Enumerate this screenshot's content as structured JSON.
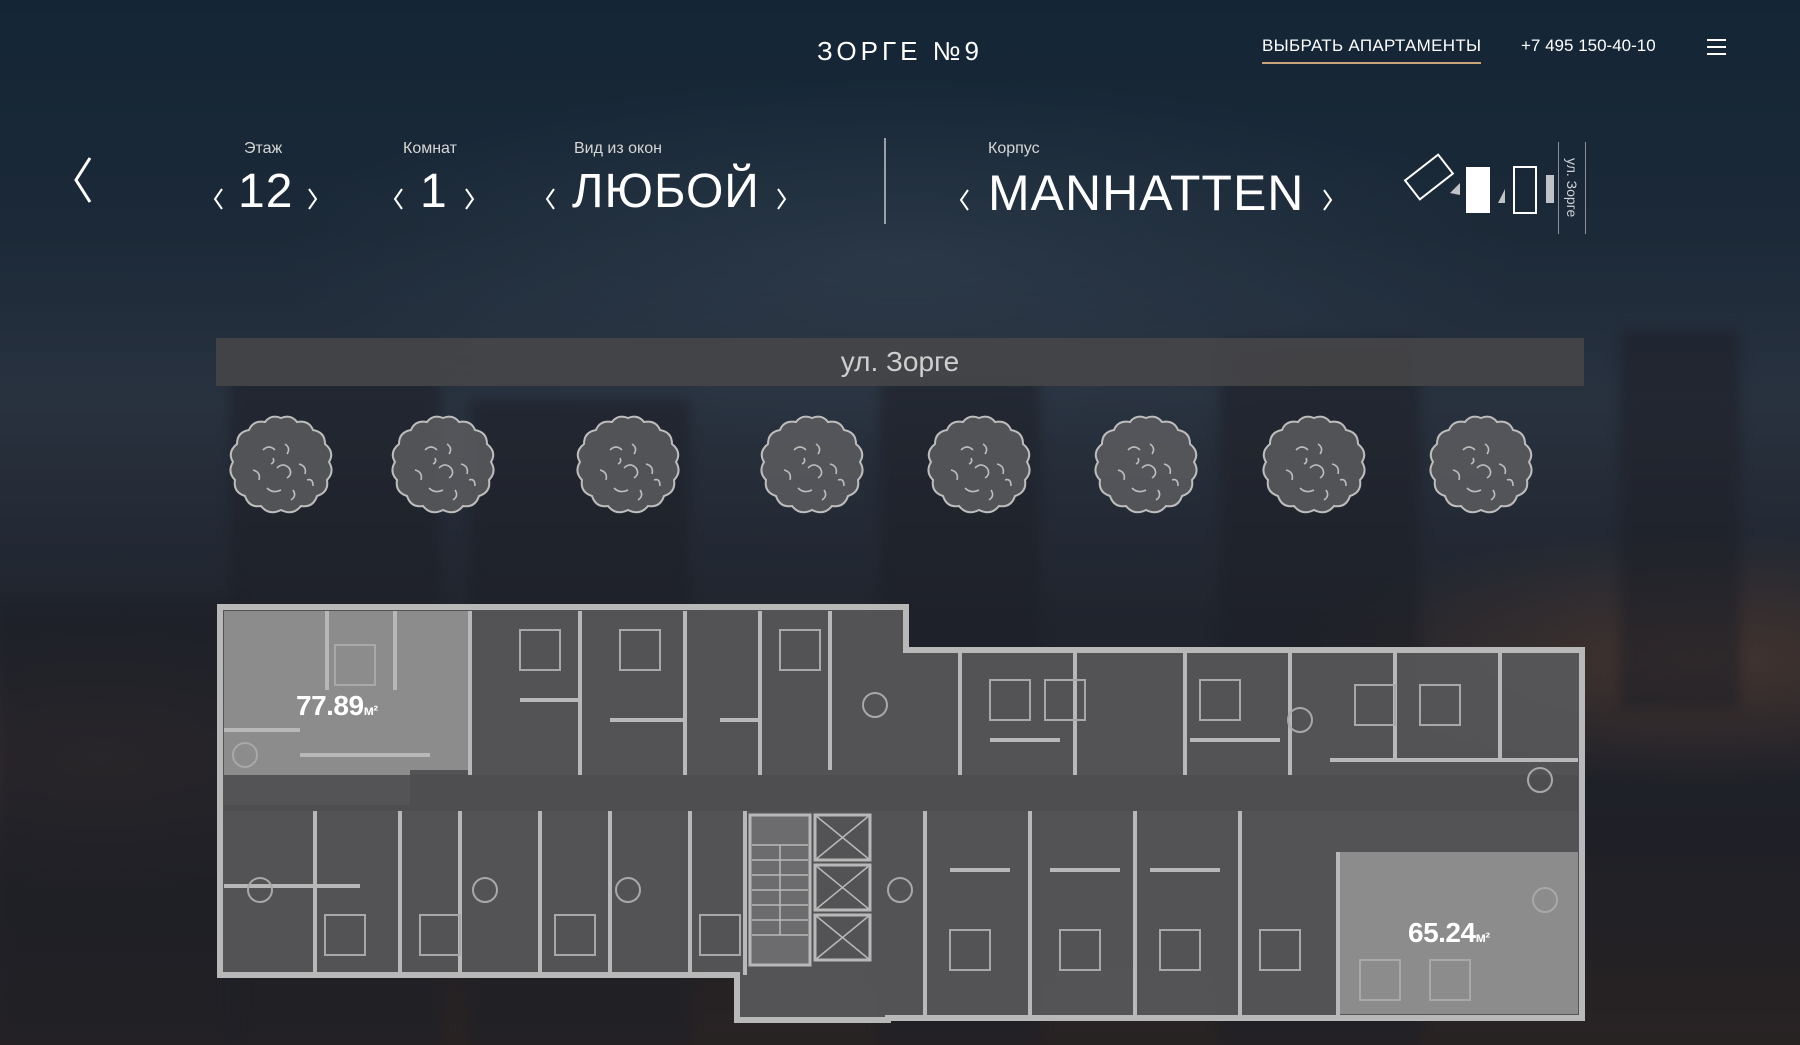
{
  "header": {
    "logo": "ЗОРГЕ №9",
    "choose_link": "ВЫБРАТЬ АПАРТАМЕНТЫ",
    "phone": "+7 495 150-40-10"
  },
  "filters": {
    "floor": {
      "label": "Этаж",
      "value": "12"
    },
    "rooms": {
      "label": "Комнат",
      "value": "1"
    },
    "view": {
      "label": "Вид из окон",
      "value": "ЛЮБОЙ"
    },
    "building": {
      "label": "Корпус",
      "value": "MANHATTEN"
    }
  },
  "building_picker": {
    "street_label": "ул. Зорге"
  },
  "street_banner": "ул. Зорге",
  "units": [
    {
      "area": "77.89",
      "unit": "м²"
    },
    {
      "area": "65.24",
      "unit": "м²"
    }
  ]
}
